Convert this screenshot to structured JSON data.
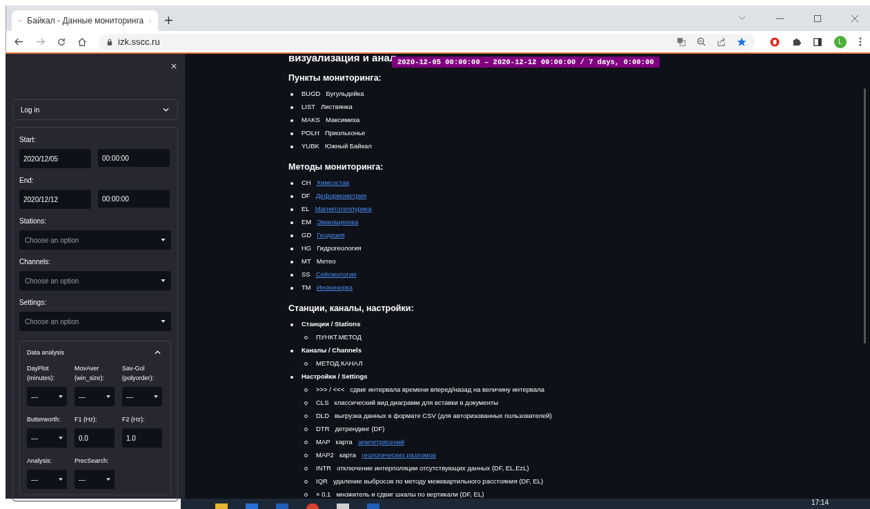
{
  "browser": {
    "tab_title": "Байкал - Данные мониторинга",
    "url": "izk.sscc.ru",
    "avatar_letter": "L"
  },
  "sidebar": {
    "login": {
      "label": "Log in",
      "expanded": false
    },
    "start_label": "Start:",
    "start_date": "2020/12/05",
    "start_time": "00:00:00",
    "end_label": "End:",
    "end_date": "2020/12/12",
    "end_time": "00:00:00",
    "selects": [
      {
        "label": "Stations:",
        "placeholder": "Choose an option"
      },
      {
        "label": "Channels:",
        "placeholder": "Choose an option"
      },
      {
        "label": "Settings:",
        "placeholder": "Choose an option"
      }
    ],
    "data_analysis": {
      "title": "Data analysis",
      "expanded": true,
      "fields": [
        {
          "label": "DayPlot (minutes):",
          "kind": "select",
          "value": "---"
        },
        {
          "label": "MovAver (win_size):",
          "kind": "select",
          "value": "---"
        },
        {
          "label": "Sav-Gol (polyorder):",
          "kind": "select",
          "value": "---"
        },
        {
          "label": "Butterworth:",
          "kind": "select",
          "value": "---"
        },
        {
          "label": "F1 (Hz):",
          "kind": "input",
          "value": "0.0"
        },
        {
          "label": "F2 (Hz):",
          "kind": "input",
          "value": "1.0"
        },
        {
          "label": "Analysis:",
          "kind": "select",
          "value": "---"
        },
        {
          "label": "PrecSearch:",
          "kind": "select",
          "value": "---"
        }
      ]
    }
  },
  "main": {
    "heading": "визуализация и анал",
    "badge": "2020-12-05 00:00:00 – 2020-12-12 00:00:00 / 7 days, 0:00:00",
    "sections": [
      {
        "title": "Пункты мониторинга:",
        "items": [
          {
            "code": "BUGD",
            "text": "Бугульдейка"
          },
          {
            "code": "LIST",
            "text": "Листвянка"
          },
          {
            "code": "MAKS",
            "text": "Максимиха"
          },
          {
            "code": "POLH",
            "text": "Приольхонье"
          },
          {
            "code": "YUBK",
            "text": "Южный Байкал"
          }
        ]
      },
      {
        "title": "Методы мониторинга:",
        "items": [
          {
            "code": "CH",
            "link": "Химсостав"
          },
          {
            "code": "DF",
            "link": "Деформометрия"
          },
          {
            "code": "EL",
            "link": "Магнитотеллурика"
          },
          {
            "code": "EM",
            "link": "Эманационка"
          },
          {
            "code": "GD",
            "link": "Геодезия"
          },
          {
            "code": "HG",
            "text": "Гидрогеология"
          },
          {
            "code": "MT",
            "text": "Метео"
          },
          {
            "code": "SS",
            "link": "Сейсмология"
          },
          {
            "code": "TM",
            "link": "Инокенерка"
          }
        ]
      },
      {
        "title": "Станции, каналы, настройки:",
        "items": [
          {
            "text": "Станции / Stations",
            "children": [
              {
                "text": "ПУНКТ.МЕТОД"
              }
            ]
          },
          {
            "text": "Каналы / Channels",
            "children": [
              {
                "text": "МЕТОД.КАНАЛ"
              }
            ]
          },
          {
            "text": "Настройки / Settings",
            "children": [
              {
                "code": ">>> / <<<",
                "text": "сдвиг интервала времени вперед/назад на величину интервала"
              },
              {
                "code": "CLS",
                "text": "классический вид диаграмм для вставки в документы"
              },
              {
                "code": "DLD",
                "text": "выгрузка данных в формате CSV (для авторизованных пользователей)"
              },
              {
                "code": "DTR",
                "text": "детрендинг (DF)"
              },
              {
                "code": "MAP",
                "text": "карта",
                "link": "землетрясений"
              },
              {
                "code": "MAP2",
                "text": "карта",
                "link": "геологических разломов"
              },
              {
                "code": "INTR",
                "text": "отключение интерполяции отсутствующих данных (DF, EL.EzL)"
              },
              {
                "code": "IQR",
                "text": "удаление выбросов по методу межквартильного расстояния (DF, EL)"
              },
              {
                "code": "× 0.1",
                "text": "множитель и сдвиг шкалы по вертикали (DF, EL)"
              }
            ]
          }
        ]
      }
    ]
  },
  "taskbar": {
    "clock": "17:14"
  }
}
